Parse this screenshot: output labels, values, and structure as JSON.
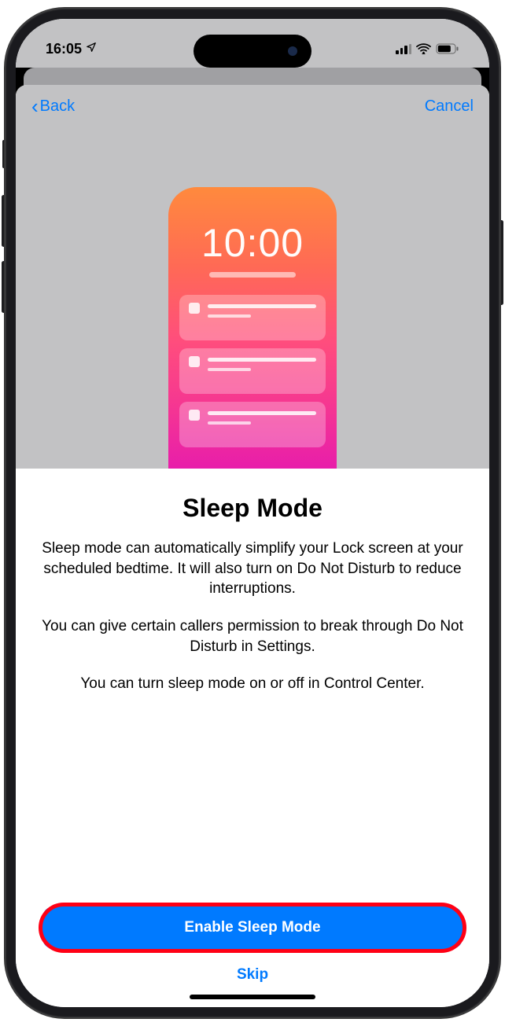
{
  "status": {
    "time": "16:05"
  },
  "nav": {
    "back_label": "Back",
    "cancel_label": "Cancel"
  },
  "preview": {
    "lock_time": "10:00"
  },
  "content": {
    "title": "Sleep Mode",
    "p1": "Sleep mode can automatically simplify your Lock screen at your scheduled bedtime. It will also turn on Do Not Disturb to reduce interruptions.",
    "p2": "You can give certain callers permission to break through Do Not Disturb in Settings.",
    "p3": "You can turn sleep mode on or off in Control Center."
  },
  "actions": {
    "primary_label": "Enable Sleep Mode",
    "skip_label": "Skip"
  },
  "colors": {
    "accent": "#007aff",
    "highlight_ring": "#ff0015"
  }
}
